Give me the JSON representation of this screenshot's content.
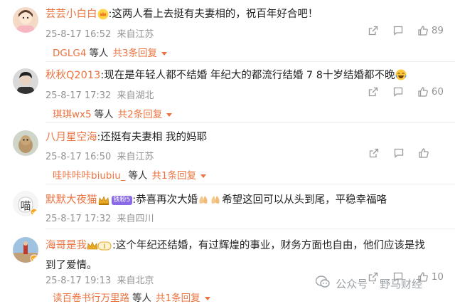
{
  "comments": [
    {
      "username": "芸芸小白白",
      "text": ":这两人看上去挺有夫妻相的，祝百年好合吧！",
      "date": "25-8-17 16:52",
      "location": "来自江苏",
      "likes": "89",
      "reply_user": "DGLG4",
      "reply_tail": "等人",
      "reply_count": "共3条回复"
    },
    {
      "username": "秋秋Q2013",
      "text": ":现在是年轻人都不结婚  年纪大的都流行结婚 7 8十岁结婚都不晚",
      "date": "25-8-17 17:32",
      "location": "来自湖北",
      "likes": "60",
      "reply_user": "琪琪wx5",
      "reply_tail": "等人",
      "reply_count": "共2条回复"
    },
    {
      "username": "八月星空海",
      "text": ":还挺有夫妻相 我的妈耶",
      "date": "25-8-17 16:50",
      "location": "来自江苏",
      "likes": "",
      "reply_user": "哇咔咔咔biubiu_",
      "reply_tail": "等人",
      "reply_count": "共1条回复"
    },
    {
      "username": "默默大夜猫",
      "fan_badge": "铁粉5",
      "text_a": ":恭喜再次大婚",
      "text_b": "希望这回可以从头到尾，平稳幸福咯",
      "date": "25-8-17 17:32",
      "location": "来自四川",
      "likes": ""
    },
    {
      "username": "海哥是我",
      "level_badge": "I",
      "text": ":这个年纪还结婚，有过辉煌的事业，财务方面也自由，他们应该是找到了爱情。",
      "date": "25-8-17 19:13",
      "location": "来自北京",
      "likes": "10",
      "reply_user": "读百卷书行万里路",
      "reply_tail": "等人",
      "reply_count": "共1条回复"
    }
  ],
  "watermark": {
    "left": "公众号",
    "dot": "·",
    "right": "野马财经"
  },
  "colors": {
    "username": "#eb7340",
    "meta": "#939393",
    "text": "#222222"
  }
}
